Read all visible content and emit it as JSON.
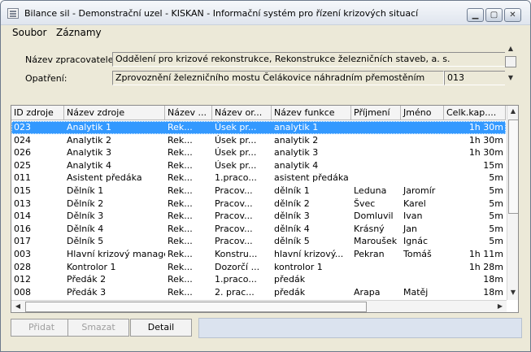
{
  "window": {
    "title": "Bilance sil - Demonstrační uzel - KISKAN - Informační systém pro řízení krizových situací",
    "min_glyph": "▁",
    "max_glyph": "▢",
    "close_glyph": "✕"
  },
  "menu": [
    "Soubor",
    "Záznamy"
  ],
  "info": {
    "processor_label": "Název zpracovatele:",
    "processor_value": "Oddělení pro krizové rekonstrukce, Rekonstrukce železničních staveb, a. s.",
    "measure_label": "Opatření:",
    "measure_value": "Zprovoznění železničního mostu Čelákovice náhradním přemostěním",
    "measure_code": "013"
  },
  "grid": {
    "columns": [
      "ID zdroje",
      "Název zdroje",
      "Název ...",
      "Název or...",
      "Název funkce",
      "Příjmení",
      "Jméno",
      "Celk.kap...."
    ],
    "rows": [
      [
        "023",
        "Analytik 1",
        "Rek...",
        "Úsek pr...",
        "analytik 1",
        "",
        "",
        "1h 30m"
      ],
      [
        "024",
        "Analytik 2",
        "Rek...",
        "Úsek pr...",
        "analytik 2",
        "",
        "",
        "1h 30m"
      ],
      [
        "026",
        "Analytik 3",
        "Rek...",
        "Úsek pr...",
        "analytik 3",
        "",
        "",
        "1h 30m"
      ],
      [
        "025",
        "Analytik 4",
        "Rek...",
        "Úsek pr...",
        "analytik 4",
        "",
        "",
        "15m"
      ],
      [
        "011",
        "Asistent předáka",
        "Rek...",
        "1.praco...",
        "asistent předáka",
        "",
        "",
        "5m"
      ],
      [
        "015",
        "Dělník 1",
        "Rek...",
        "Pracov...",
        "dělník 1",
        "Leduna",
        "Jaromír",
        "5m"
      ],
      [
        "013",
        "Dělník 2",
        "Rek...",
        "Pracov...",
        "dělník 2",
        "Švec",
        "Karel",
        "5m"
      ],
      [
        "014",
        "Dělník 3",
        "Rek...",
        "Pracov...",
        "dělník 3",
        "Domluvil",
        "Ivan",
        "5m"
      ],
      [
        "016",
        "Dělník 4",
        "Rek...",
        "Pracov...",
        "dělník 4",
        "Krásný",
        "Jan",
        "5m"
      ],
      [
        "017",
        "Dělník 5",
        "Rek...",
        "Pracov...",
        "dělník 5",
        "Maroušek",
        "Ignác",
        "5m"
      ],
      [
        "003",
        "Hlavní krizový manager",
        "Rek...",
        "Konstru...",
        "hlavní krizový...",
        "Pekran",
        "Tomáš",
        "1h 11m"
      ],
      [
        "028",
        "Kontrolor 1",
        "Rek...",
        "Dozorčí ...",
        "kontrolor 1",
        "",
        "",
        "1h 28m"
      ],
      [
        "012",
        "Předák 2",
        "Rek...",
        "1.praco...",
        "předák",
        "",
        "",
        "18m"
      ],
      [
        "008",
        "Předák 3",
        "Rek...",
        "2. prac...",
        "předák",
        "Arapa",
        "Matěj",
        "18m"
      ]
    ]
  },
  "buttons": {
    "add": "Přidat",
    "delete": "Smazat",
    "detail": "Detail"
  }
}
